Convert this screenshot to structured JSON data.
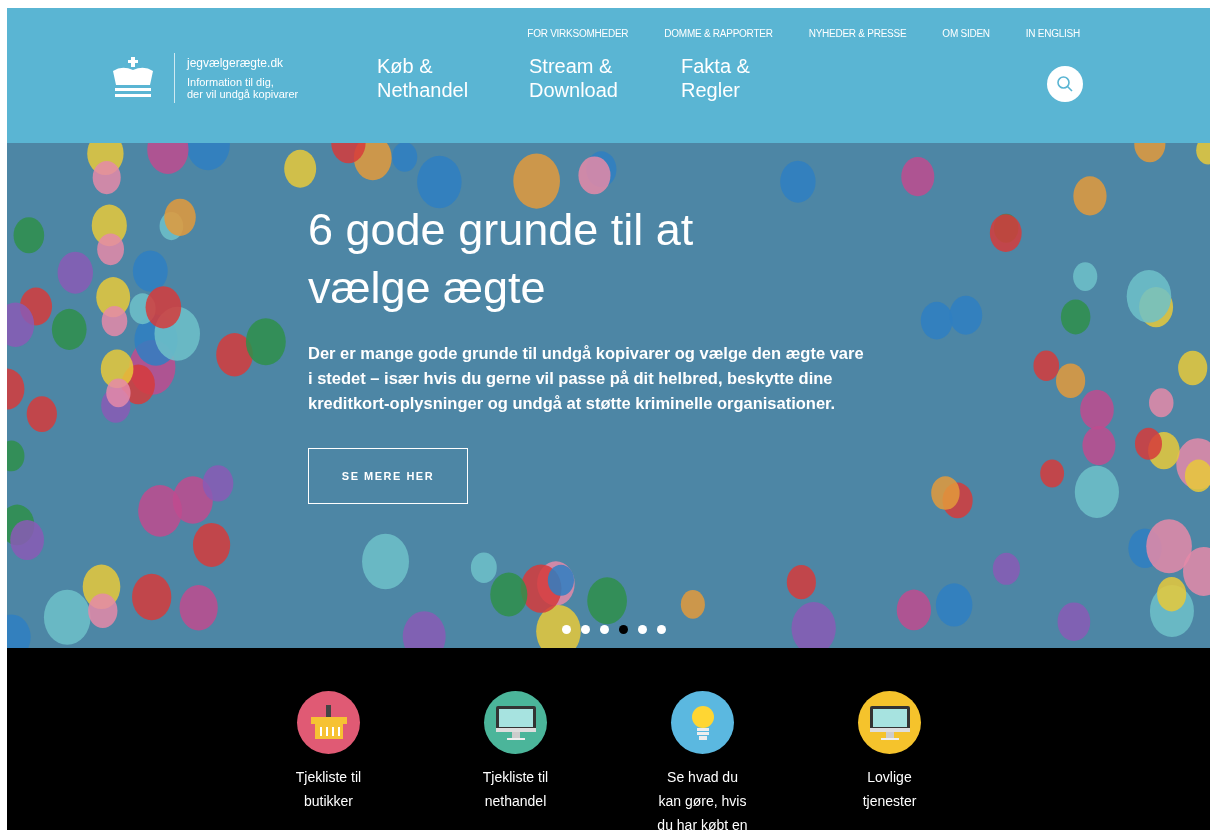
{
  "top_links": [
    "FOR VIRKSOMHEDER",
    "DOMME & RAPPORTER",
    "NYHEDER & PRESSE",
    "OM SIDEN",
    "IN ENGLISH"
  ],
  "logo": {
    "site": "jegvælgerægte.dk",
    "tagline": [
      "Information til dig,",
      "der vil undgå kopivarer"
    ]
  },
  "nav": [
    {
      "lines": [
        "Køb &",
        "Nethandel"
      ]
    },
    {
      "lines": [
        "Stream &",
        "Download"
      ]
    },
    {
      "lines": [
        "Fakta &",
        "Regler"
      ]
    }
  ],
  "hero": {
    "title": [
      "6 gode grunde til at",
      "vælge ægte"
    ],
    "text": [
      "Der er mange gode grunde til undgå kopivarer og vælge den ægte vare",
      "i stedet – især hvis du gerne vil passe på dit helbred, beskytte dine",
      "kreditkort-oplysninger og undgå at støtte kriminelle organisationer."
    ],
    "button": "SE MERE HER",
    "dots": [
      {
        "selected": false
      },
      {
        "selected": false
      },
      {
        "selected": false
      },
      {
        "selected": true
      },
      {
        "selected": false
      },
      {
        "selected": false
      }
    ]
  },
  "features": [
    {
      "kind": "basket",
      "color": "#e05a74",
      "lines": [
        "Tjekliste til",
        "butikker"
      ]
    },
    {
      "kind": "monitor",
      "color": "#4bb59a",
      "lines": [
        "Tjekliste til",
        "nethandel"
      ]
    },
    {
      "kind": "bulb",
      "color": "#5bb8e0",
      "lines": [
        "Se hvad du",
        "kan gøre, hvis",
        "du har købt en"
      ]
    },
    {
      "kind": "monitor",
      "color": "#f5c32c",
      "lines": [
        "Lovlige",
        "tjenester"
      ]
    }
  ]
}
